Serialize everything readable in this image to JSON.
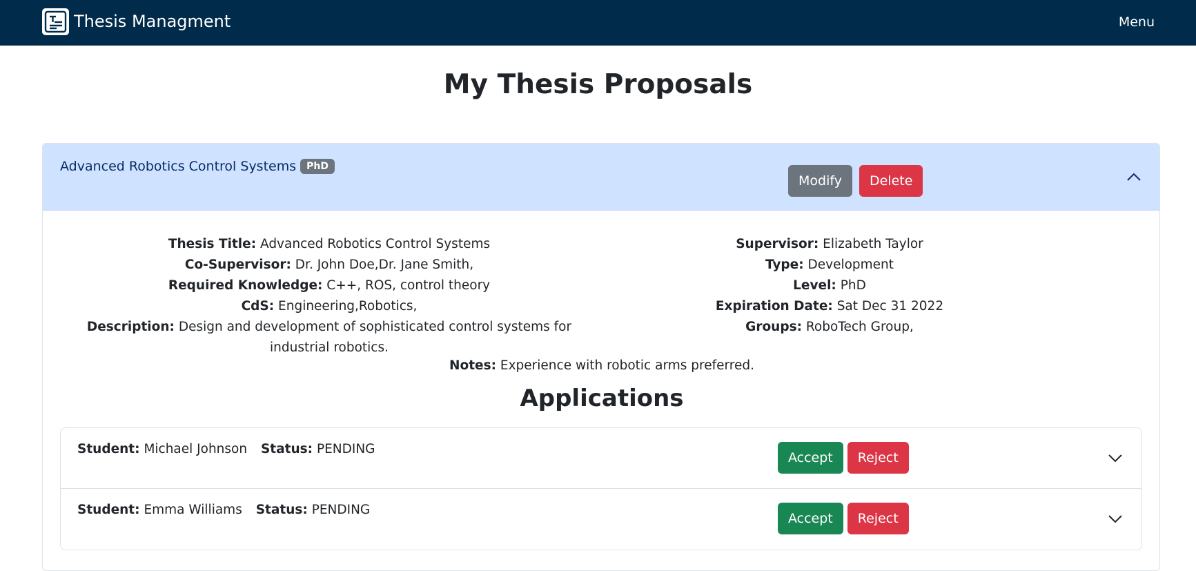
{
  "navbar": {
    "brand": "Thesis Managment",
    "menu_label": "Menu"
  },
  "page": {
    "title": "My Thesis Proposals"
  },
  "proposal": {
    "title": "Advanced Robotics Control Systems",
    "level_badge": "PhD",
    "modify_label": "Modify",
    "delete_label": "Delete",
    "details": {
      "thesis_title_label": "Thesis Title:",
      "thesis_title": "Advanced Robotics Control Systems",
      "co_supervisor_label": "Co-Supervisor:",
      "co_supervisor": "Dr. John Doe,Dr. Jane Smith,",
      "required_knowledge_label": "Required Knowledge:",
      "required_knowledge": "C++, ROS, control theory",
      "cds_label": "CdS:",
      "cds": "Engineering,Robotics,",
      "description_label": "Description:",
      "description": "Design and development of sophisticated control systems for industrial robotics.",
      "supervisor_label": "Supervisor:",
      "supervisor": "Elizabeth Taylor",
      "type_label": "Type:",
      "type": "Development",
      "level_label": "Level:",
      "level": "PhD",
      "expiration_label": "Expiration Date:",
      "expiration": "Sat Dec 31 2022",
      "groups_label": "Groups:",
      "groups": "RoboTech Group,",
      "notes_label": "Notes:",
      "notes": "Experience with robotic arms preferred."
    }
  },
  "applications": {
    "title": "Applications",
    "student_label": "Student:",
    "status_label": "Status:",
    "accept_label": "Accept",
    "reject_label": "Reject",
    "items": [
      {
        "student": "Michael Johnson",
        "status": "PENDING"
      },
      {
        "student": "Emma Williams",
        "status": "PENDING"
      }
    ]
  },
  "colors": {
    "navbar": "#002b4a",
    "header_bg": "#cfe2ff",
    "danger": "#dc3545",
    "success": "#198754",
    "secondary": "#6c757d"
  }
}
